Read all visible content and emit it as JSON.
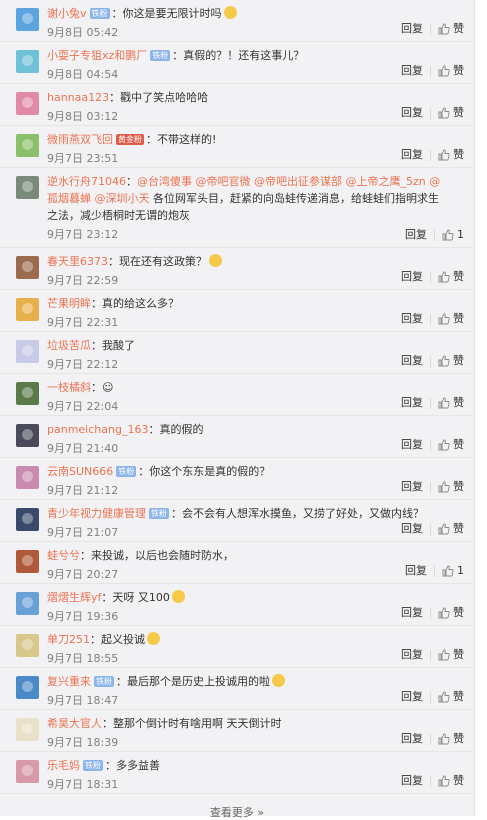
{
  "footer": {
    "more_label": "查看更多 »"
  },
  "actions": {
    "reply": "回复",
    "like": "赞"
  },
  "comments": [
    {
      "user": "谢小兔v",
      "badge": "铁粉",
      "badge_color": "#8bb5e8",
      "segments": [
        {
          "text": "：你这是要无限计时吗",
          "type": "text"
        }
      ],
      "emoji": true,
      "time": "9月8日 05:42",
      "likes": "赞",
      "avatar_color": "#5ba4e0"
    },
    {
      "user": "小耍子专狙xz和鹏厂",
      "badge": "铁粉",
      "badge_color": "#8bb5e8",
      "segments": [
        {
          "text": "：真假的？！还有这事儿？",
          "type": "text"
        }
      ],
      "emoji": false,
      "time": "9月8日 04:54",
      "likes": "赞",
      "avatar_color": "#6fc2d6"
    },
    {
      "user": "hannaa123",
      "badge": "",
      "badge_color": "",
      "segments": [
        {
          "text": "：戳中了笑点哈哈哈",
          "type": "text"
        }
      ],
      "emoji": false,
      "time": "9月8日 03:12",
      "likes": "赞",
      "avatar_color": "#e08aa6"
    },
    {
      "user": "微雨燕双飞回",
      "badge": "黄金粉",
      "badge_color": "#e05a4a",
      "segments": [
        {
          "text": "：不带这样的!",
          "type": "text"
        }
      ],
      "emoji": false,
      "time": "9月7日 23:51",
      "likes": "赞",
      "avatar_color": "#8bbf6a"
    },
    {
      "user": "逆水行舟71046",
      "badge": "",
      "badge_color": "",
      "segments": [
        {
          "text": "：",
          "type": "text"
        },
        {
          "text": "@台湾傻事",
          "type": "mention"
        },
        {
          "text": " ",
          "type": "text"
        },
        {
          "text": "@帝吧官微",
          "type": "mention"
        },
        {
          "text": " ",
          "type": "text"
        },
        {
          "text": "@帝吧出征参谋部",
          "type": "mention"
        },
        {
          "text": " ",
          "type": "text"
        },
        {
          "text": "@上帝之鹰_5zn",
          "type": "mention"
        },
        {
          "text": " ",
          "type": "text"
        },
        {
          "text": "@孤烟暮蝉",
          "type": "mention"
        },
        {
          "text": " ",
          "type": "text"
        },
        {
          "text": "@深圳小天",
          "type": "mention"
        },
        {
          "text": " 各位网军头目，赶紧的向岛蛙传递消息，给蛙蛙们指明求生之法，减少梧桐时无谓的炮灰",
          "type": "text"
        }
      ],
      "emoji": false,
      "time": "9月7日 23:12",
      "likes": "1",
      "avatar_color": "#7a8a7a"
    },
    {
      "user": "春天里6373",
      "badge": "",
      "badge_color": "",
      "segments": [
        {
          "text": "：现在还有这政策？",
          "type": "text"
        }
      ],
      "emoji": true,
      "time": "9月7日 22:59",
      "likes": "赞",
      "avatar_color": "#9b6b4f"
    },
    {
      "user": "芒果明眸",
      "badge": "",
      "badge_color": "",
      "segments": [
        {
          "text": "：真的给这么多？",
          "type": "text"
        }
      ],
      "emoji": false,
      "time": "9月7日 22:31",
      "likes": "赞",
      "avatar_color": "#e8b04a"
    },
    {
      "user": "垃圾苦瓜",
      "badge": "",
      "badge_color": "",
      "segments": [
        {
          "text": "：我酸了",
          "type": "text"
        }
      ],
      "emoji": false,
      "time": "9月7日 22:12",
      "likes": "赞",
      "avatar_color": "#c9c9e8"
    },
    {
      "user": "一枝橘斜",
      "badge": "",
      "badge_color": "",
      "segments": [
        {
          "text": "：☺",
          "type": "text"
        }
      ],
      "emoji": false,
      "time": "9月7日 22:04",
      "likes": "赞",
      "avatar_color": "#5a7a4a"
    },
    {
      "user": "panmeichang_163",
      "badge": "",
      "badge_color": "",
      "segments": [
        {
          "text": "：真的假的",
          "type": "text"
        }
      ],
      "emoji": false,
      "time": "9月7日 21:40",
      "likes": "赞",
      "avatar_color": "#4a4a5a"
    },
    {
      "user": "云南SUN666",
      "badge": "铁粉",
      "badge_color": "#8bb5e8",
      "segments": [
        {
          "text": "：你这个东东是真的假的？",
          "type": "text"
        }
      ],
      "emoji": false,
      "time": "9月7日 21:12",
      "likes": "赞",
      "avatar_color": "#c98ab0"
    },
    {
      "user": "青少年视力健康管理",
      "badge": "铁粉",
      "badge_color": "#8bb5e8",
      "segments": [
        {
          "text": "：会不会有人想浑水摸鱼，又捞了好处，又做内线？",
          "type": "text"
        }
      ],
      "emoji": false,
      "time": "9月7日 21:07",
      "likes": "赞",
      "avatar_color": "#3a4a6a"
    },
    {
      "user": "蛙兮兮",
      "badge": "",
      "badge_color": "",
      "segments": [
        {
          "text": "：来投诚，以后也会随时防水，",
          "type": "text"
        }
      ],
      "emoji": false,
      "time": "9月7日 20:27",
      "likes": "1",
      "avatar_color": "#b05a3a"
    },
    {
      "user": "熠熠生辉yf",
      "badge": "",
      "badge_color": "",
      "segments": [
        {
          "text": "：天呀 又100",
          "type": "text"
        }
      ],
      "emoji": true,
      "time": "9月7日 19:36",
      "likes": "赞",
      "avatar_color": "#6aa0d8"
    },
    {
      "user": "单刀251",
      "badge": "",
      "badge_color": "",
      "segments": [
        {
          "text": "：起义投诚",
          "type": "text"
        }
      ],
      "emoji": true,
      "time": "9月7日 18:55",
      "likes": "赞",
      "avatar_color": "#d8c88a"
    },
    {
      "user": "复兴重来",
      "badge": "铁粉",
      "badge_color": "#8bb5e8",
      "segments": [
        {
          "text": "：最后那个是历史上投诚用的啦",
          "type": "text"
        }
      ],
      "emoji": true,
      "time": "9月7日 18:47",
      "likes": "赞",
      "avatar_color": "#4a8ac8"
    },
    {
      "user": "希昊大官人",
      "badge": "",
      "badge_color": "",
      "segments": [
        {
          "text": "：整那个倒计时有啥用啊 天天倒计时",
          "type": "text"
        }
      ],
      "emoji": false,
      "time": "9月7日 18:39",
      "likes": "赞",
      "avatar_color": "#e8e0c8"
    },
    {
      "user": "乐毛妈",
      "badge": "铁粉",
      "badge_color": "#8bb5e8",
      "segments": [
        {
          "text": "：多多益善",
          "type": "text"
        }
      ],
      "emoji": false,
      "time": "9月7日 18:31",
      "likes": "赞",
      "avatar_color": "#d89aa8"
    }
  ]
}
